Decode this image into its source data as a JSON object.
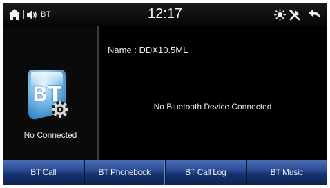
{
  "status_bar": {
    "bt_label": "BT",
    "time": "12:17",
    "icons": [
      "home-icon",
      "volume-icon",
      "brightness-icon",
      "settings-icon",
      "back-icon"
    ]
  },
  "left_panel": {
    "logo_text": "BT",
    "status": "No Connected"
  },
  "right_panel": {
    "device_name": "Name : DDX10.5ML",
    "message": "No Bluetooth Device Connected"
  },
  "tabs": [
    {
      "label": "BT Call"
    },
    {
      "label": "BT Phonebook"
    },
    {
      "label": "BT Call Log"
    },
    {
      "label": "BT Music"
    }
  ],
  "colors": {
    "tab_gradient_top": "#4d6fb6",
    "tab_gradient_bottom": "#0f2356",
    "background": "#000000",
    "text": "#eaeaea"
  }
}
